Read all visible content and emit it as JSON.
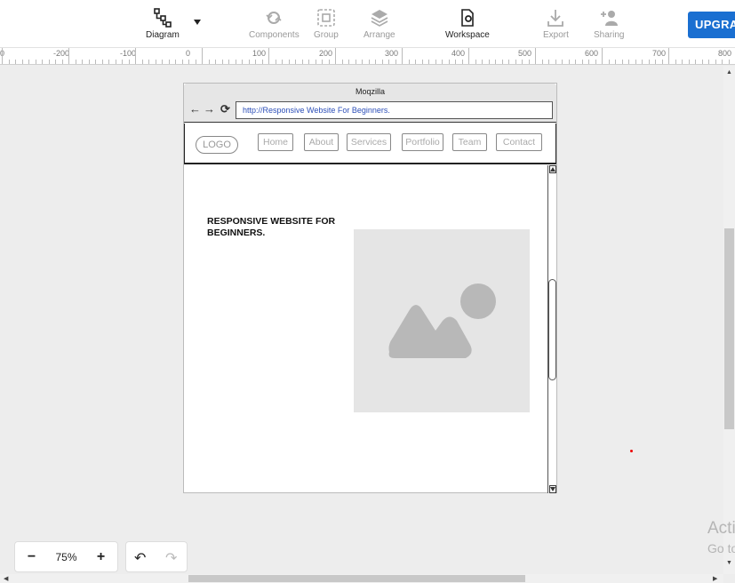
{
  "toolbar": {
    "diagram": "Diagram",
    "components": "Components",
    "group": "Group",
    "arrange": "Arrange",
    "workspace": "Workspace",
    "export": "Export",
    "sharing": "Sharing",
    "upgrade": "UPGRA"
  },
  "ruler": {
    "labels": [
      "0",
      "-200",
      "-100",
      "0",
      "100",
      "200",
      "300",
      "400",
      "500",
      "600",
      "700",
      "800"
    ]
  },
  "mockup": {
    "title": "Moqzilla",
    "url": "http://Responsive Website For Beginners.",
    "logo": "LOGO",
    "nav": [
      "Home",
      "About",
      "Services",
      "Portfolio",
      "Team",
      "Contact"
    ],
    "hero_line1": "RESPONSIVE WEBSITE FOR",
    "hero_line2": "BEGINNERS."
  },
  "zoom": {
    "minus": "−",
    "level": "75%",
    "plus": "+"
  },
  "watermark": {
    "line1": "Acti",
    "line2": "Go to"
  },
  "colors": {
    "accent": "#1a6fd1",
    "canvas": "#ededed",
    "placeholder": "#e5e5e5"
  }
}
